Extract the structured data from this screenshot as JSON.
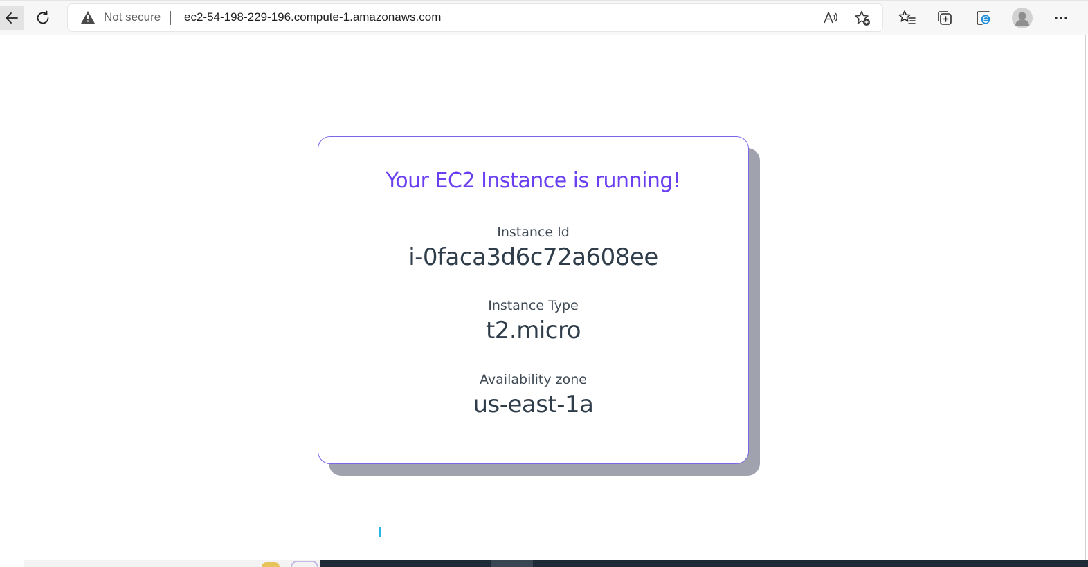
{
  "browser": {
    "security_label": "Not secure",
    "url": "ec2-54-198-229-196.compute-1.amazonaws.com",
    "icons": {
      "back": "back-arrow-icon",
      "refresh": "refresh-icon",
      "warning": "warning-triangle-icon",
      "read_aloud": "read-aloud-icon",
      "add_favorite": "add-favorite-icon",
      "favorites": "favorites-list-icon",
      "collections": "collections-icon",
      "ie_mode": "ie-mode-icon",
      "profile": "profile-avatar-icon",
      "more": "more-options-icon"
    }
  },
  "page": {
    "title": "Your EC2 Instance is running!",
    "fields": [
      {
        "label": "Instance Id",
        "value": "i-0faca3d6c72a608ee"
      },
      {
        "label": "Instance Type",
        "value": "t2.micro"
      },
      {
        "label": "Availability zone",
        "value": "us-east-1a"
      }
    ]
  },
  "colors": {
    "title": "#6a3ff0",
    "card_border": "#7c66e8",
    "card_shadow": "#a0a3ad",
    "text": "#2f3d4b",
    "loader": "#29b6e8"
  }
}
